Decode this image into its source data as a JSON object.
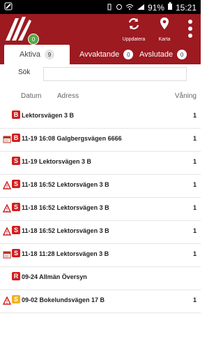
{
  "status_bar": {
    "battery": "91%",
    "time": "15:21"
  },
  "app": {
    "unread_badge": "0"
  },
  "toolbar": {
    "update_label": "Uppdatera",
    "map_label": "Karta"
  },
  "tabs": [
    {
      "label": "Aktiva",
      "count": "9"
    },
    {
      "label": "Avvaktande",
      "count": "0"
    },
    {
      "label": "Avslutade",
      "count": "0"
    }
  ],
  "search": {
    "label": "Sök",
    "placeholder": ""
  },
  "columns": {
    "date": "Datum",
    "address": "Adress",
    "floor": "Våning"
  },
  "rows": [
    {
      "type": "B",
      "color": "#d31e1e",
      "warn": false,
      "calendar": false,
      "text": "Lektorsvägen 3 B",
      "floor": "1"
    },
    {
      "type": "B",
      "color": "#d31e1e",
      "warn": false,
      "calendar": true,
      "text": "11-19 16:08 Galgbergsvägen 6666",
      "floor": "1"
    },
    {
      "type": "S",
      "color": "#d31e1e",
      "warn": false,
      "calendar": false,
      "text": "11-19 Lektorsvägen 3 B",
      "floor": "1"
    },
    {
      "type": "S",
      "color": "#d31e1e",
      "warn": true,
      "calendar": false,
      "text": "11-18 16:52 Lektorsvägen 3 B",
      "floor": "1"
    },
    {
      "type": "S",
      "color": "#d31e1e",
      "warn": true,
      "calendar": false,
      "text": "11-18 16:52 Lektorsvägen 3 B",
      "floor": "1"
    },
    {
      "type": "S",
      "color": "#d31e1e",
      "warn": true,
      "calendar": false,
      "text": "11-18 16:52 Lektorsvägen 3 B",
      "floor": "1"
    },
    {
      "type": "S",
      "color": "#d31e1e",
      "warn": false,
      "calendar": true,
      "text": "11-18 11:28 Lektorsvägen 3 B",
      "floor": "1"
    },
    {
      "type": "R",
      "color": "#d31e1e",
      "warn": false,
      "calendar": false,
      "text": "09-24 Allmän Översyn",
      "floor": ""
    },
    {
      "type": "S",
      "color": "#f2b21c",
      "warn": true,
      "calendar": false,
      "text": "09-02 Bokelundsvägen 17 B",
      "floor": "1"
    }
  ]
}
